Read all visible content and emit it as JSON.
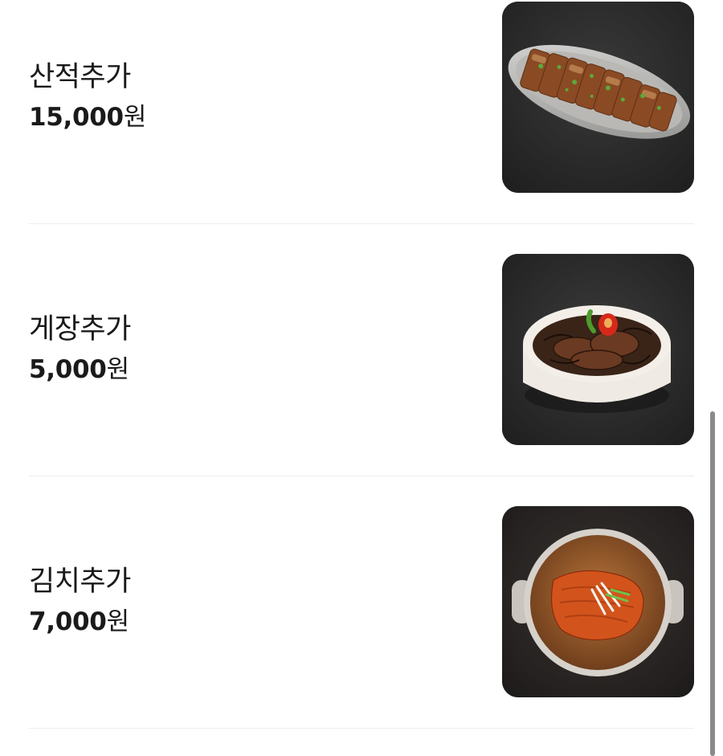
{
  "menu": {
    "items": [
      {
        "name": "산적추가",
        "price": "15,000",
        "currency": "원",
        "image_icon": "grilled-meat-platter-image"
      },
      {
        "name": "게장추가",
        "price": "5,000",
        "currency": "원",
        "image_icon": "soy-crab-bowl-image"
      },
      {
        "name": "김치추가",
        "price": "7,000",
        "currency": "원",
        "image_icon": "kimchi-pot-image"
      }
    ]
  },
  "colors": {
    "text": "#1a1a1a",
    "divider": "#ededed",
    "image_bg": "#2b2b2b",
    "scrollbar": "#8a8a8a"
  }
}
